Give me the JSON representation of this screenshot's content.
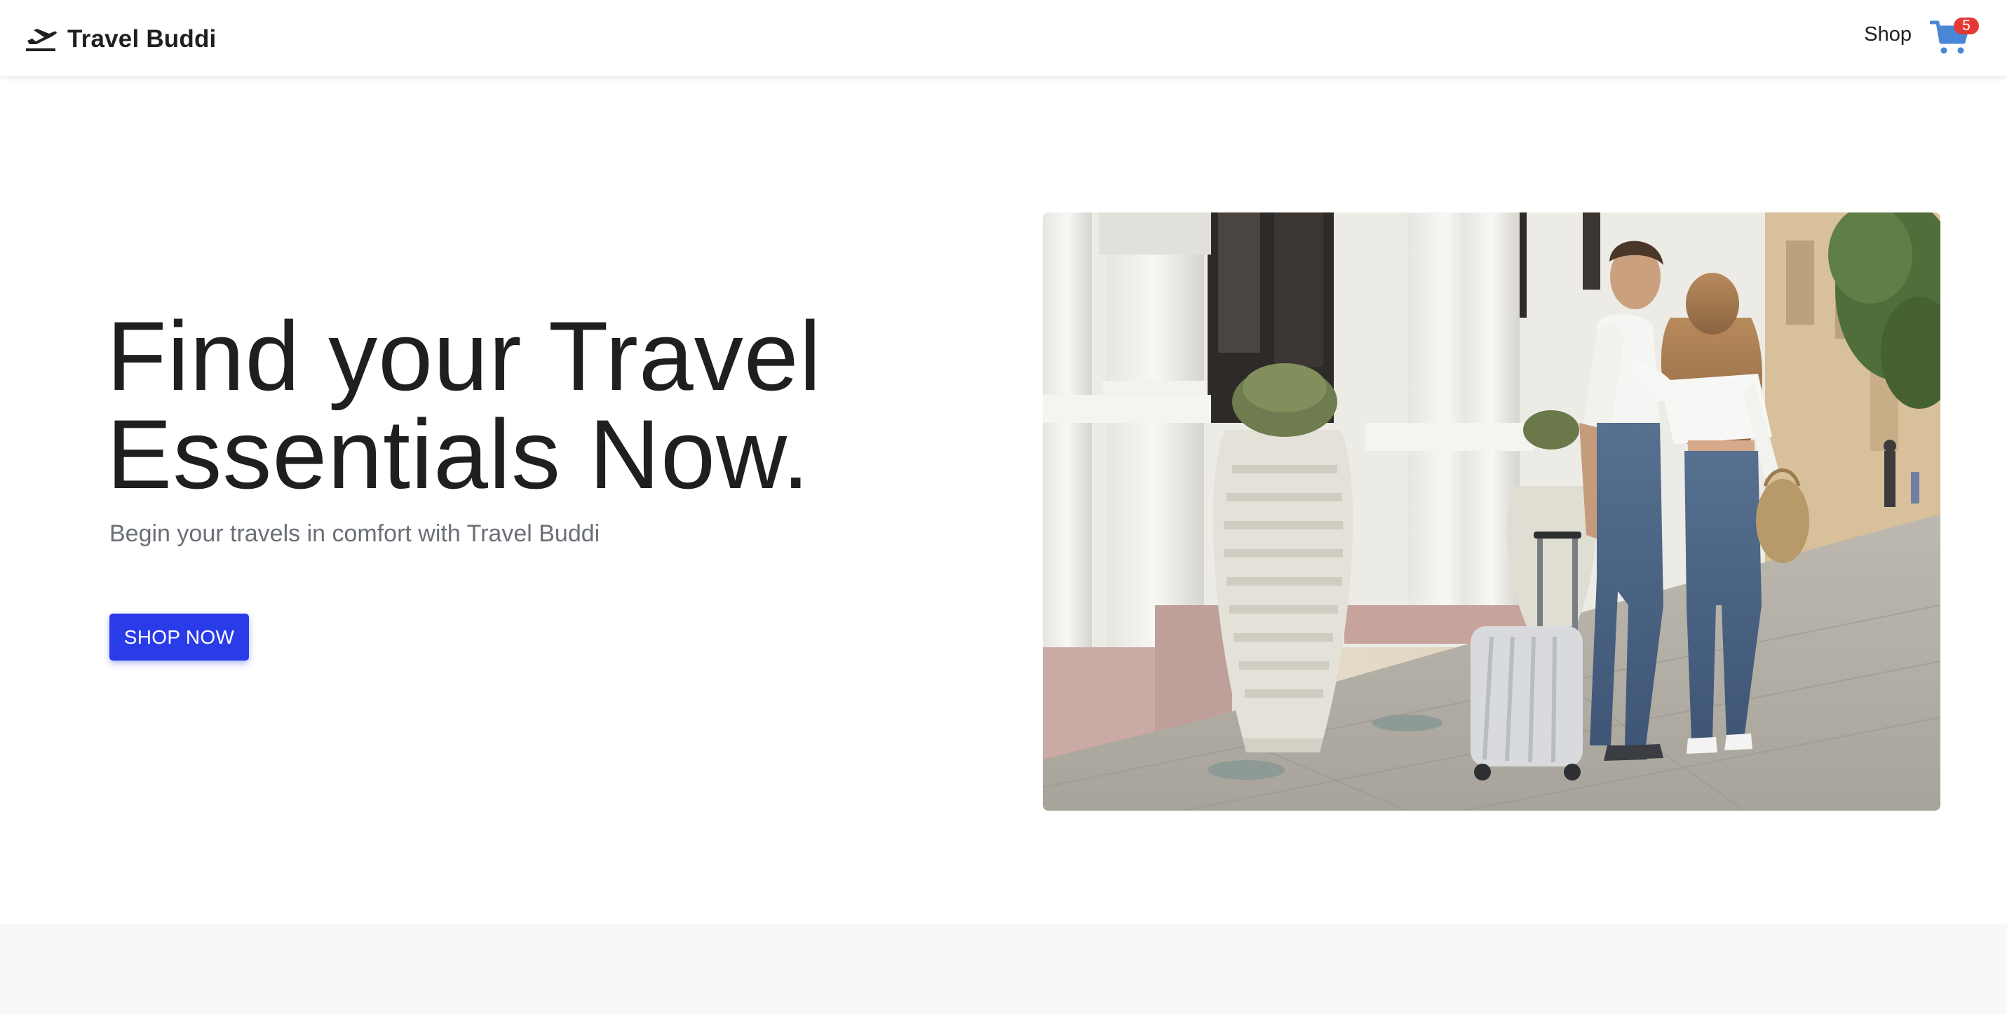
{
  "navbar": {
    "brand_name": "Travel Buddi",
    "brand_icon": "airplane-departure-icon",
    "links": [
      {
        "label": "Shop"
      }
    ],
    "cart": {
      "icon": "shopping-cart-icon",
      "count": "5",
      "icon_color": "#4a86d6",
      "badge_color": "#e53935"
    }
  },
  "hero": {
    "title_line1": "Find your Travel",
    "title_line2": "Essentials Now.",
    "subtitle": "Begin your travels in comfort with Travel Buddi",
    "cta_label": "SHOP NOW",
    "cta_color": "#2a3ce8",
    "image_description_icon": "couple-with-suitcase-photo"
  }
}
